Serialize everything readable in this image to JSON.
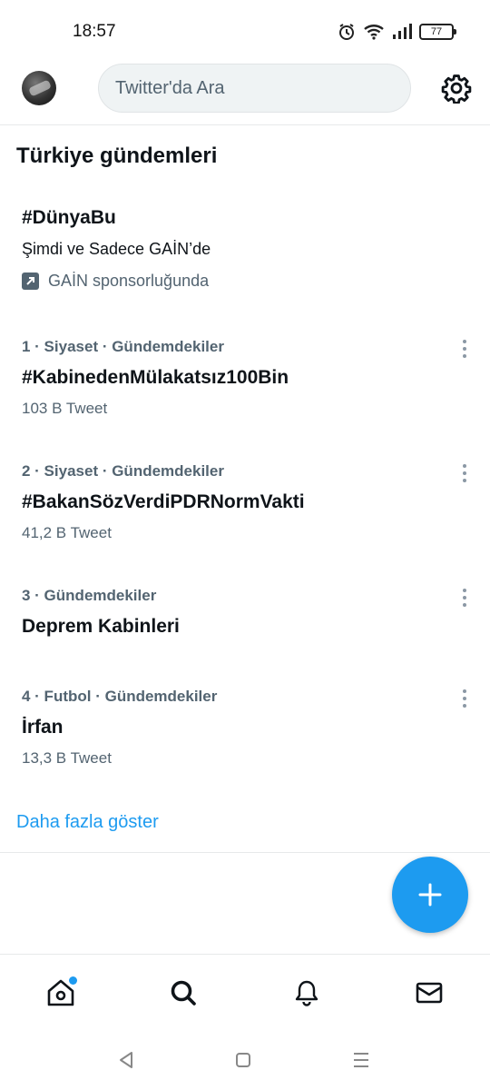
{
  "status_bar": {
    "time": "18:57",
    "battery": "77"
  },
  "header": {
    "search_placeholder": "Twitter'da Ara"
  },
  "section": {
    "title": "Türkiye gündemleri"
  },
  "promoted": {
    "tag": "#DünyaBu",
    "description": "Şimdi ve Sadece GAİN’de",
    "sponsor": "GAİN sponsorluğunda"
  },
  "trends": [
    {
      "meta": "1 · Siyaset · Gündemdekiler",
      "title": "#KabinedenMülakatsız100Bin",
      "count": "103 B Tweet"
    },
    {
      "meta": "2 · Siyaset · Gündemdekiler",
      "title": "#BakanSözVerdiPDRNormVakti",
      "count": "41,2 B Tweet"
    },
    {
      "meta": "3 · Gündemdekiler",
      "title": "Deprem Kabinleri",
      "count": ""
    },
    {
      "meta": "4 · Futbol · Gündemdekiler",
      "title": "İrfan",
      "count": "13,3 B Tweet"
    }
  ],
  "show_more": "Daha fazla göster",
  "icons": {
    "settings": "gear-icon",
    "home": "home-icon",
    "search": "search-icon",
    "notifications": "bell-icon",
    "messages": "mail-icon",
    "compose": "plus-icon"
  },
  "colors": {
    "accent": "#1d9bf0",
    "secondary_text": "#536471"
  }
}
